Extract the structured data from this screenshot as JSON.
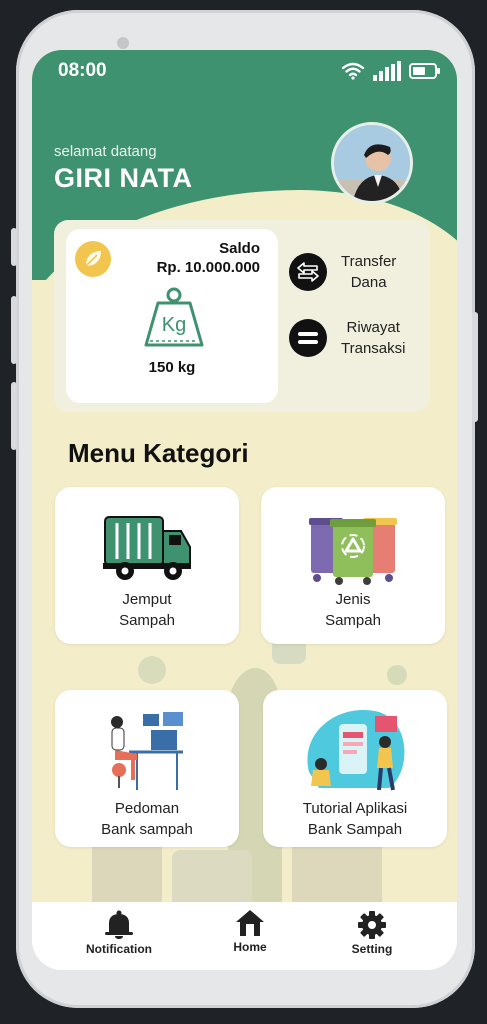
{
  "status_bar": {
    "time": "08:00"
  },
  "header": {
    "greeting": "selamat datang",
    "username": "GIRI NATA"
  },
  "wallet": {
    "saldo_label": "Saldo",
    "saldo_value": "Rp. 10.000.000",
    "weight_value": "150 kg",
    "weight_icon_text": "Kg",
    "actions": [
      {
        "label_line1": "Transfer",
        "label_line2": "Dana"
      },
      {
        "label_line1": "Riwayat",
        "label_line2": "Transaksi"
      }
    ]
  },
  "menu": {
    "title": "Menu Kategori",
    "items": [
      {
        "line1": "Jemput",
        "line2": "Sampah"
      },
      {
        "line1": "Jenis",
        "line2": "Sampah"
      },
      {
        "line1": "Pedoman",
        "line2": "Bank sampah"
      },
      {
        "line1": "Tutorial Aplikasi",
        "line2": "Bank Sampah"
      }
    ]
  },
  "bottom_nav": {
    "items": [
      {
        "label": "Notification",
        "icon": "bell-icon"
      },
      {
        "label": "Home",
        "icon": "home-icon"
      },
      {
        "label": "Setting",
        "icon": "gear-icon"
      }
    ]
  },
  "colors": {
    "primary_green": "#3f9270",
    "background_cream": "#f4edc9",
    "accent_yellow": "#f2c64e"
  }
}
